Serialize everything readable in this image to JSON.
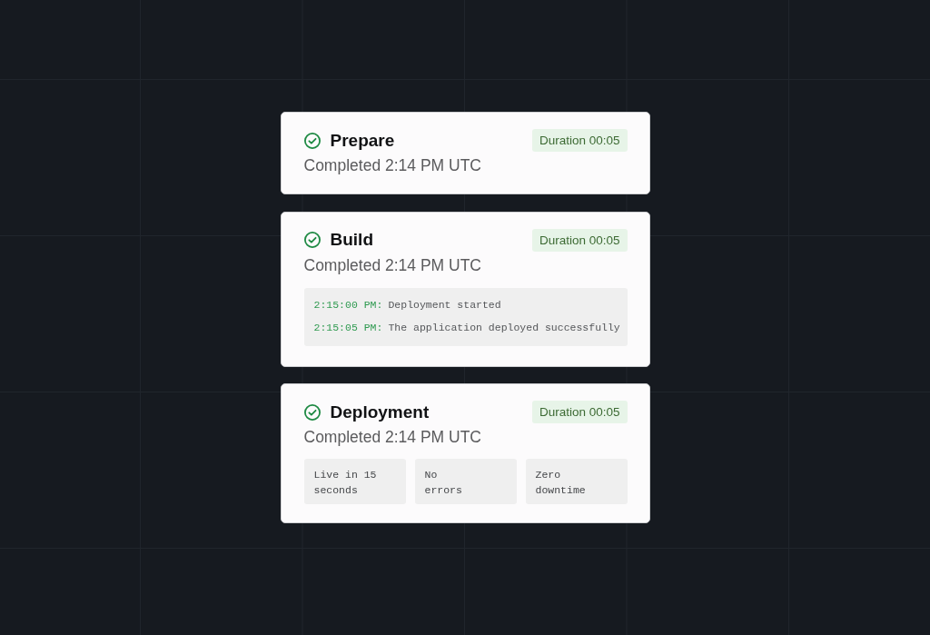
{
  "steps": [
    {
      "kind": "plain",
      "title": "Prepare",
      "completed": true,
      "duration": "Duration 00:05",
      "subtitle": "Completed 2:14 PM UTC"
    },
    {
      "kind": "log",
      "title": "Build",
      "completed": true,
      "duration": "Duration 00:05",
      "subtitle": "Completed 2:14 PM UTC",
      "log": [
        {
          "time": "2:15:00 PM:",
          "message": "Deployment started"
        },
        {
          "time": "2:15:05 PM:",
          "message": "The application deployed successfully"
        }
      ]
    },
    {
      "kind": "stats",
      "title": "Deployment",
      "completed": true,
      "duration": "Duration 00:05",
      "subtitle": "Completed 2:14 PM UTC",
      "stats": [
        "Live in 15\nseconds",
        "No\nerrors",
        "Zero\ndowntime"
      ]
    }
  ]
}
